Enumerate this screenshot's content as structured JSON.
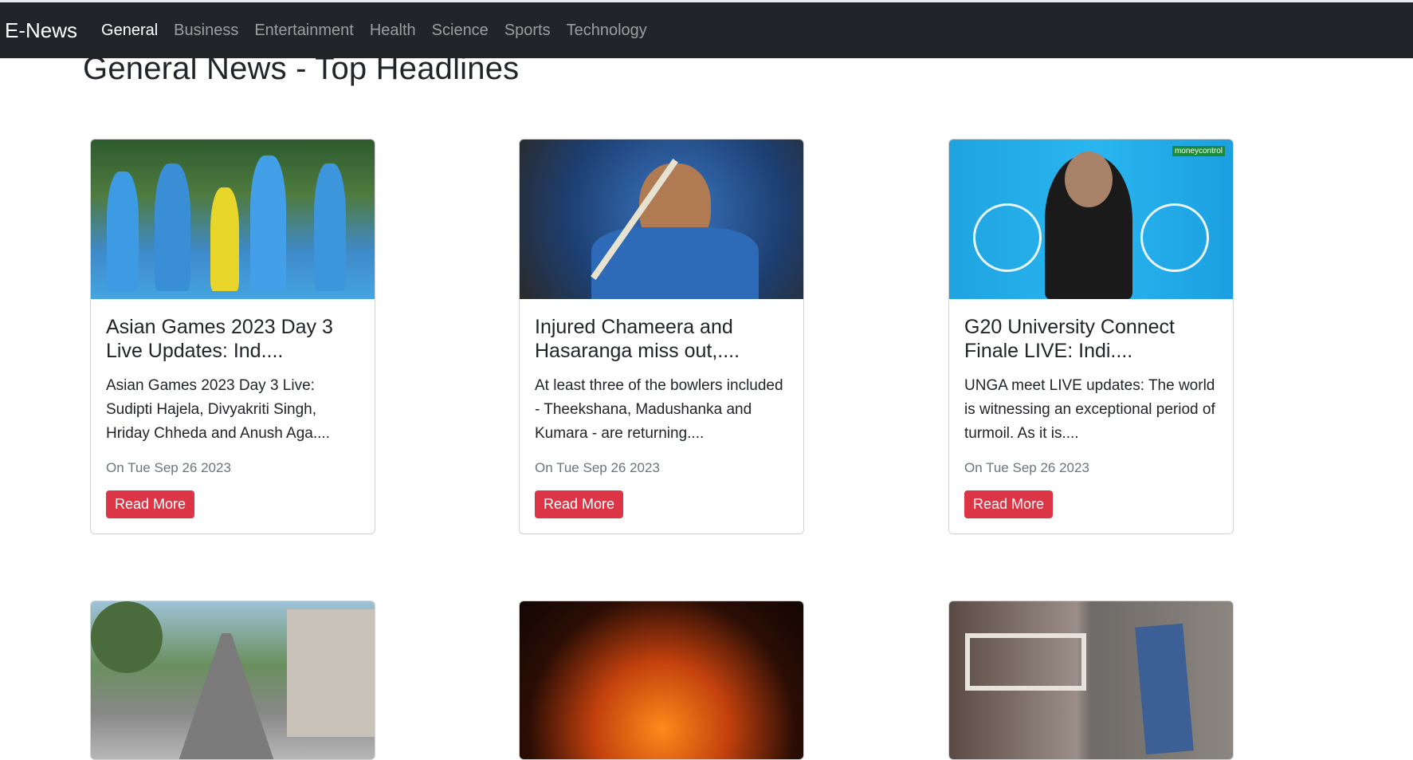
{
  "nav": {
    "brand": "E-News",
    "links": [
      "General",
      "Business",
      "Entertainment",
      "Health",
      "Science",
      "Sports",
      "Technology"
    ],
    "active": "General"
  },
  "page": {
    "title": "General News - Top Headlines"
  },
  "cards": [
    {
      "title": "Asian Games 2023 Day 3 Live Updates: Ind....",
      "description": "Asian Games 2023 Day 3 Live: Sudipti Hajela, Divyakriti Singh, Hriday Chheda and Anush Aga....",
      "date": "On Tue Sep 26 2023",
      "button": "Read More"
    },
    {
      "title": "Injured Chameera and Hasaranga miss out,....",
      "description": "At least three of the bowlers included - Theekshana, Madushanka and Kumara - are returning....",
      "date": "On Tue Sep 26 2023",
      "button": "Read More"
    },
    {
      "title": "G20 University Connect Finale LIVE: Indi....",
      "description": "UNGA meet LIVE updates: The world is witnessing an exceptional period of turmoil. As it is....",
      "date": "On Tue Sep 26 2023",
      "button": "Read More",
      "image_watermark": "moneycontrol"
    },
    {
      "title": "",
      "description": "",
      "date": "",
      "button": ""
    },
    {
      "title": "",
      "description": "",
      "date": "",
      "button": ""
    },
    {
      "title": "",
      "description": "",
      "date": "",
      "button": ""
    }
  ],
  "colors": {
    "navbar": "#212529",
    "button": "#dc3545",
    "muted": "#6c757d"
  }
}
